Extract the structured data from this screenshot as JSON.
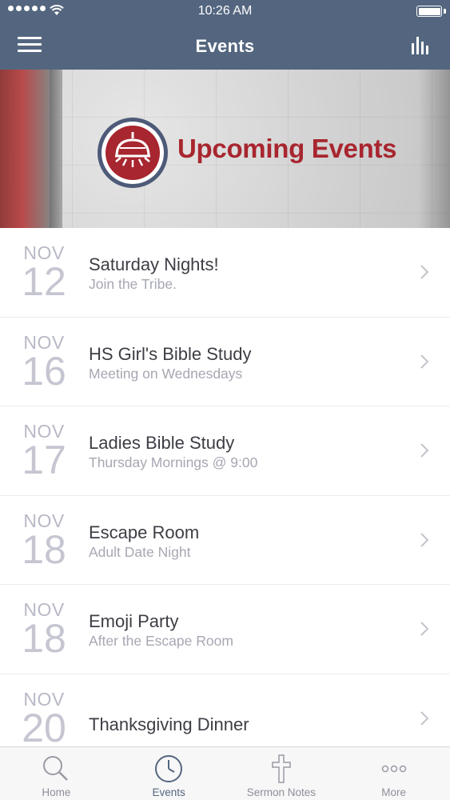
{
  "status_bar": {
    "time": "10:26 AM"
  },
  "nav": {
    "title": "Events",
    "menu_icon": "hamburger-menu-icon",
    "right_icon": "bar-chart-icon"
  },
  "banner": {
    "headline": "Upcoming Events",
    "emblem_icon": "bell-lamp-emblem-icon"
  },
  "events": [
    {
      "month": "NOV",
      "day": "12",
      "title": "Saturday Nights!",
      "subtitle": "Join the Tribe."
    },
    {
      "month": "NOV",
      "day": "16",
      "title": "HS Girl's Bible Study",
      "subtitle": "Meeting on Wednesdays"
    },
    {
      "month": "NOV",
      "day": "17",
      "title": "Ladies Bible Study",
      "subtitle": "Thursday Mornings @ 9:00"
    },
    {
      "month": "NOV",
      "day": "18",
      "title": "Escape Room",
      "subtitle": "Adult Date Night"
    },
    {
      "month": "NOV",
      "day": "18",
      "title": "Emoji Party",
      "subtitle": "After the Escape Room"
    },
    {
      "month": "NOV",
      "day": "20",
      "title": "Thanksgiving Dinner",
      "subtitle": ""
    }
  ],
  "tabs": [
    {
      "label": "Home",
      "icon": "search-icon",
      "active": false
    },
    {
      "label": "Events",
      "icon": "clock-icon",
      "active": true
    },
    {
      "label": "Sermon Notes",
      "icon": "cross-icon",
      "active": false
    },
    {
      "label": "More",
      "icon": "more-dots-icon",
      "active": false
    }
  ],
  "colors": {
    "header": "#54667f",
    "accent_red": "#a8262f",
    "date_gray": "#c5c6d1"
  }
}
